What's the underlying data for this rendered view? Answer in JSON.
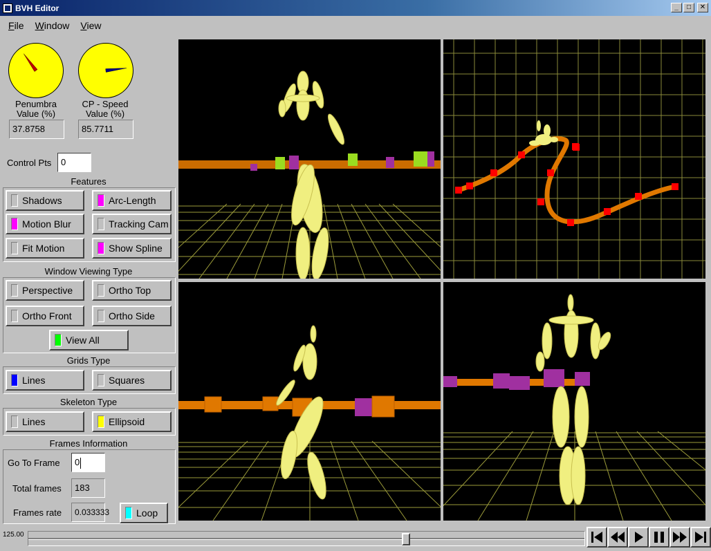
{
  "window": {
    "title": "BVH Editor"
  },
  "menu": [
    "File",
    "Window",
    "View"
  ],
  "dials": [
    {
      "label_line1": "Penumbra",
      "label_line2": "Value (%)",
      "value": "37.8758",
      "needle_percent": 37.8758
    },
    {
      "label_line1": "CP - Speed",
      "label_line2": "Value (%)",
      "value": "85.7711",
      "needle_percent": 85.7711
    }
  ],
  "control_pts": {
    "label": "Control Pts",
    "value": "0"
  },
  "features": {
    "title": "Features",
    "shadows": "Shadows",
    "arc_length": "Arc-Length",
    "motion_blur": "Motion Blur",
    "tracking_cam": "Tracking Cam",
    "fit_motion": "Fit Motion",
    "show_spline": "Show Spline"
  },
  "viewing": {
    "title": "Window Viewing Type",
    "perspective": "Perspective",
    "ortho_top": "Ortho Top",
    "ortho_front": "Ortho Front",
    "ortho_side": "Ortho Side",
    "view_all": "View All"
  },
  "grids": {
    "title": "Grids Type",
    "lines": "Lines",
    "squares": "Squares"
  },
  "skeleton": {
    "title": "Skeleton Type",
    "lines": "Lines",
    "ellipsoid": "Ellipsoid"
  },
  "frames": {
    "title": "Frames Information",
    "goto_label": "Go To Frame",
    "goto_value": "0",
    "total_label": "Total frames",
    "total_value": "183",
    "rate_label": "Frames rate",
    "rate_value": "0.033333",
    "loop": "Loop"
  },
  "timeline": {
    "frame_label": "125.00",
    "position_percent": 68.3
  },
  "colors": {
    "indicator_on_magenta": "#ff00ff",
    "indicator_on_green": "#00ff00",
    "indicator_on_blue": "#0000ff",
    "indicator_on_yellow": "#ffff00",
    "indicator_on_cyan": "#00ffff",
    "dial": "#ffff00",
    "spline": "#e07800"
  }
}
